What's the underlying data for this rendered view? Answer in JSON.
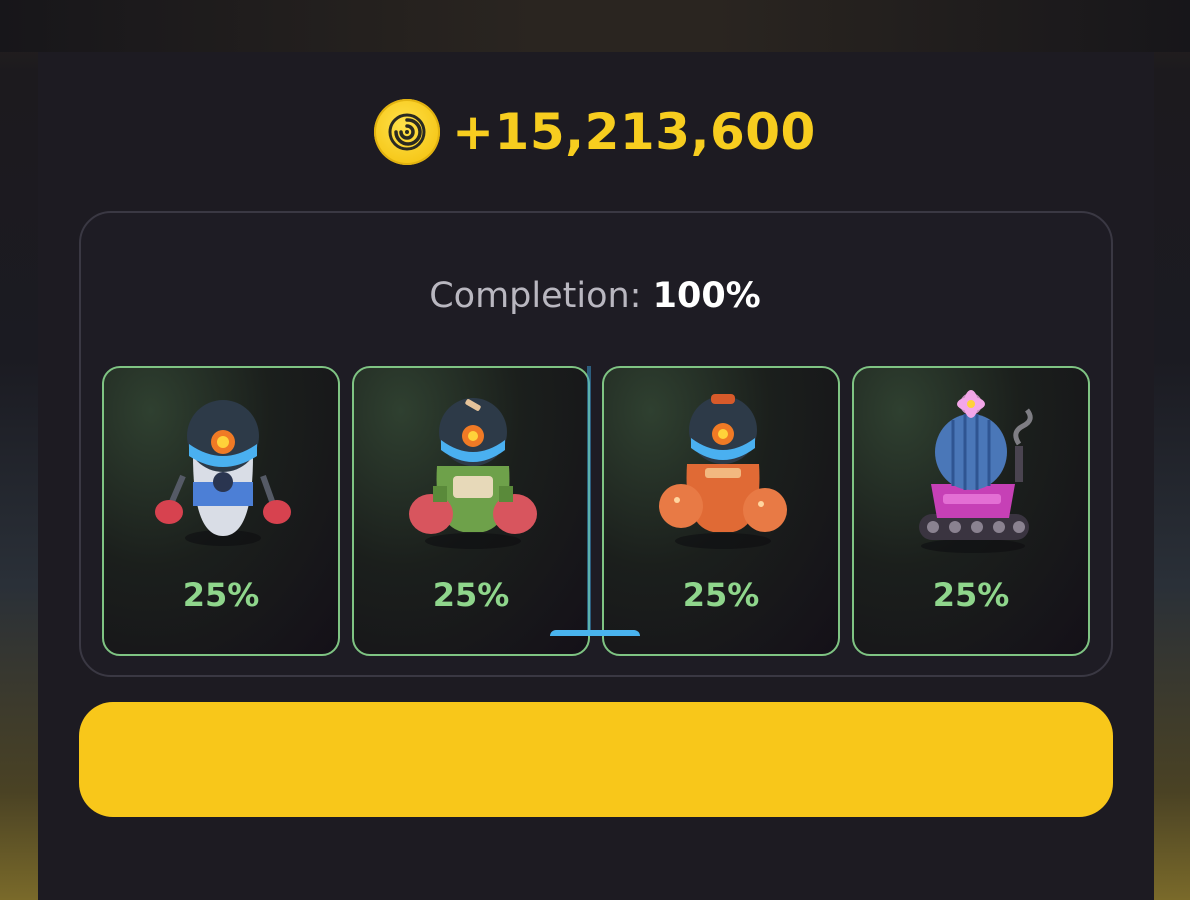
{
  "reward": {
    "amount": "+15,213,600",
    "icon": "coin-icon"
  },
  "completion": {
    "label": "Completion:",
    "value": "100%"
  },
  "items": [
    {
      "name": "blue-boxer-robot",
      "percent": "25%",
      "fraction": 0.25
    },
    {
      "name": "green-mech-robot",
      "percent": "25%",
      "fraction": 0.25
    },
    {
      "name": "orange-mech-robot",
      "percent": "25%",
      "fraction": 0.25
    },
    {
      "name": "cactus-tank-robot",
      "percent": "25%",
      "fraction": 0.25
    }
  ],
  "action_button": {
    "label": ""
  },
  "colors": {
    "accent_yellow": "#f8c71a",
    "item_border_green": "#7fc483",
    "percent_green": "#8fd68c"
  }
}
